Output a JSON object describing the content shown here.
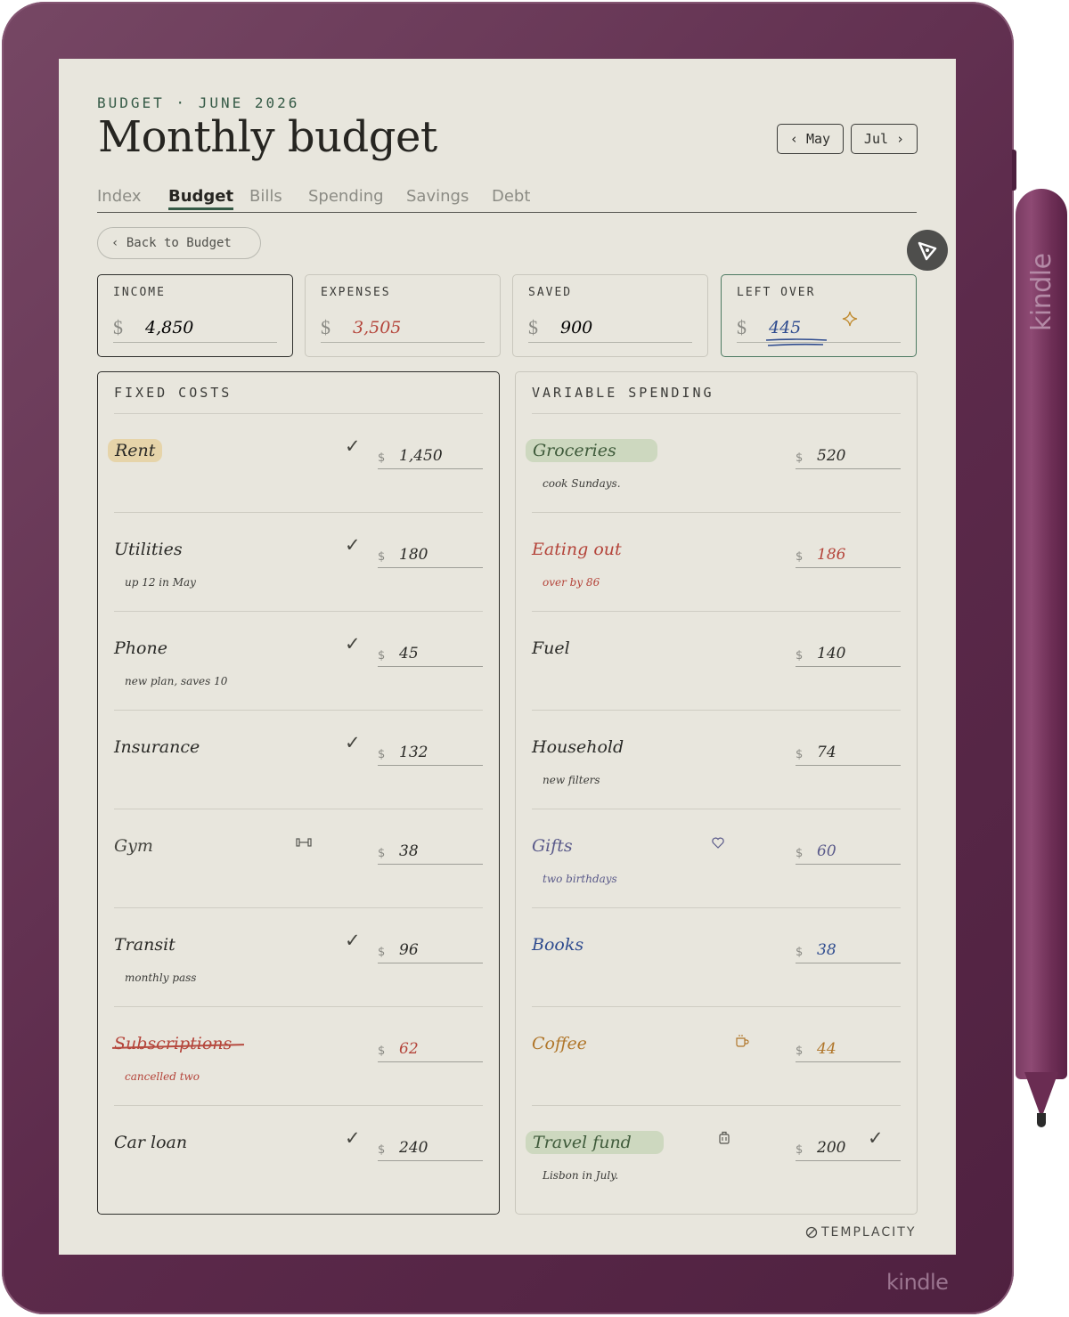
{
  "device": {
    "logo": "kindle",
    "pen_logo": "kindle"
  },
  "header": {
    "eyebrow": "BUDGET · JUNE 2026",
    "title": "Monthly budget"
  },
  "month_nav": {
    "prev": "‹ May",
    "next": "Jul ›"
  },
  "tabs": [
    {
      "label": "Index",
      "active": false
    },
    {
      "label": "Budget",
      "active": true
    },
    {
      "label": "Bills",
      "active": false
    },
    {
      "label": "Spending",
      "active": false
    },
    {
      "label": "Savings",
      "active": false
    },
    {
      "label": "Debt",
      "active": false
    }
  ],
  "back_button": "‹ Back to Budget",
  "pen_tool_icon": "pen-nib-icon",
  "summary": [
    {
      "label": "INCOME",
      "currency": "$",
      "value": "4,850",
      "color": "#2a2a27"
    },
    {
      "label": "EXPENSES",
      "currency": "$",
      "value": "3,505",
      "color": "#b4443a"
    },
    {
      "label": "SAVED",
      "currency": "$",
      "value": "900",
      "color": "#2a2a27"
    },
    {
      "label": "LEFT OVER",
      "currency": "$",
      "value": "445",
      "color": "#2f4c8f"
    }
  ],
  "fixed_costs": {
    "title": "FIXED COSTS",
    "rows": [
      {
        "name": "Rent",
        "note": "",
        "checked": true,
        "icon": "",
        "currency": "$",
        "amount": "1,450",
        "highlight": "#e6d4a9"
      },
      {
        "name": "Utilities",
        "note": "up 12 in May",
        "checked": true,
        "icon": "",
        "currency": "$",
        "amount": "180"
      },
      {
        "name": "Phone",
        "note": "new plan, saves 10",
        "checked": true,
        "icon": "",
        "currency": "$",
        "amount": "45"
      },
      {
        "name": "Insurance",
        "note": "",
        "checked": true,
        "icon": "",
        "currency": "$",
        "amount": "132"
      },
      {
        "name": "Gym",
        "note": "",
        "checked": false,
        "icon": "dumbbell-icon",
        "currency": "$",
        "amount": "38"
      },
      {
        "name": "Transit",
        "note": "monthly pass",
        "checked": true,
        "icon": "",
        "currency": "$",
        "amount": "96"
      },
      {
        "name": "Subscriptions",
        "note": "cancelled two",
        "checked": false,
        "icon": "",
        "currency": "$",
        "amount": "62",
        "struck": true,
        "color": "#b4443a"
      },
      {
        "name": "Car loan",
        "note": "",
        "checked": true,
        "icon": "",
        "currency": "$",
        "amount": "240"
      }
    ]
  },
  "variable_spending": {
    "title": "VARIABLE SPENDING",
    "rows": [
      {
        "name": "Groceries",
        "note": "cook Sundays.",
        "checked": false,
        "icon": "",
        "currency": "$",
        "amount": "520",
        "highlight": "#cdd8bf"
      },
      {
        "name": "Eating out",
        "note": "over by 86",
        "checked": false,
        "icon": "",
        "currency": "$",
        "amount": "186",
        "color": "#b4443a"
      },
      {
        "name": "Fuel",
        "note": "",
        "checked": false,
        "icon": "",
        "currency": "$",
        "amount": "140"
      },
      {
        "name": "Household",
        "note": "new filters",
        "checked": false,
        "icon": "",
        "currency": "$",
        "amount": "74"
      },
      {
        "name": "Gifts",
        "note": "two birthdays",
        "checked": false,
        "icon": "heart-icon",
        "currency": "$",
        "amount": "60",
        "color": "#5a5a8a"
      },
      {
        "name": "Books",
        "note": "",
        "checked": false,
        "icon": "",
        "currency": "$",
        "amount": "38",
        "color": "#2f4c8f"
      },
      {
        "name": "Coffee",
        "note": "",
        "checked": false,
        "icon": "coffee-cup-icon",
        "currency": "$",
        "amount": "44",
        "color": "#b0762a"
      },
      {
        "name": "Travel fund",
        "note": "Lisbon in July.",
        "checked": true,
        "icon": "luggage-icon",
        "currency": "$",
        "amount": "200",
        "highlight": "#cdd8bf"
      }
    ]
  },
  "footer": {
    "brand": "TEMPLACITY"
  }
}
